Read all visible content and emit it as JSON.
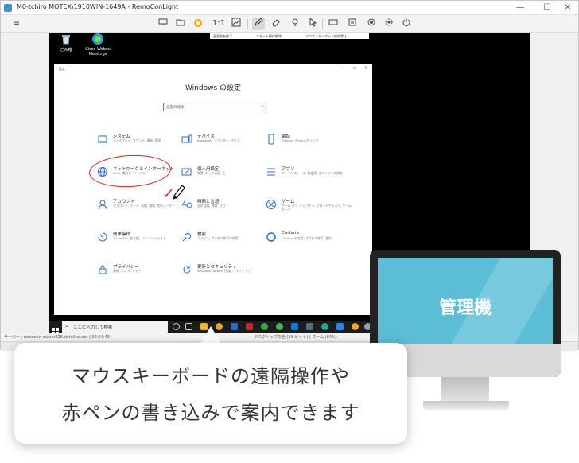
{
  "window": {
    "title": "M0-tchiro MOTEX\\1910WIN-1649A - RemoConLight",
    "minimize": "—",
    "maximize": "☐",
    "close": "✕"
  },
  "toolbar": {
    "menu_icon": "≡",
    "zoom_label": "1:1"
  },
  "remote": {
    "notify": {
      "item1": "画面共有終了",
      "item2": "リモート操作解除",
      "item3": "マウス・キーボード操作禁止"
    },
    "desktop_icons": [
      {
        "label": "ごみ箱"
      },
      {
        "label": "Cisco Webex Meetings"
      }
    ],
    "settings": {
      "title": "設定",
      "heading": "Windows の設定",
      "search_placeholder": "設定の検索",
      "categories": [
        {
          "name": "システム",
          "desc": "ディスプレイ, サウンド, 通知, 電源"
        },
        {
          "name": "デバイス",
          "desc": "Bluetooth, プリンター, マウス"
        },
        {
          "name": "電話",
          "desc": "Android, iPhone のリンク"
        },
        {
          "name": "ネットワークとインターネット",
          "desc": "Wi-Fi, 機内モード, VPN"
        },
        {
          "name": "個人用設定",
          "desc": "背景, ロック画面, 色"
        },
        {
          "name": "アプリ",
          "desc": "アンインストール, 既定値, オプションの機能"
        },
        {
          "name": "アカウント",
          "desc": "アカウント, メール, 同期, 職場, 他のユーザー"
        },
        {
          "name": "時刻と言語",
          "desc": "音声認識, 地域, 日付"
        },
        {
          "name": "ゲーム",
          "desc": "ゲーム バー, キャプチャ, ブロードキャスト, ゲーム モード"
        },
        {
          "name": "簡単操作",
          "desc": "ナレーター, 拡大鏡, ハイ コントラスト"
        },
        {
          "name": "検索",
          "desc": "ファイル, アクセス許可の検索"
        },
        {
          "name": "Cortana",
          "desc": "Cortana の言語, アクセス許可, 通知"
        },
        {
          "name": "プライバシー",
          "desc": "場所, カメラ, マイク"
        },
        {
          "name": "更新とセキュリティ",
          "desc": "Windows Update, 回復, バックアップ"
        }
      ]
    },
    "taskbar": {
      "search_placeholder": "ここに入力して検索"
    }
  },
  "status": {
    "left": "サーバー : remocon-server226.strlnline.net | 00:04:43",
    "right": "デスクトップの色 (16 ビット) | ズーム (84%)"
  },
  "monitor": {
    "label": "管理機"
  },
  "callout": {
    "line1": "マウスキーボードの遠隔操作や",
    "line2": "赤ペンの書き込みで案内できます"
  },
  "colors": {
    "accent": "#4a7fc8",
    "red_pen": "#e02020",
    "monitor_screen": "#5bbdd6"
  }
}
